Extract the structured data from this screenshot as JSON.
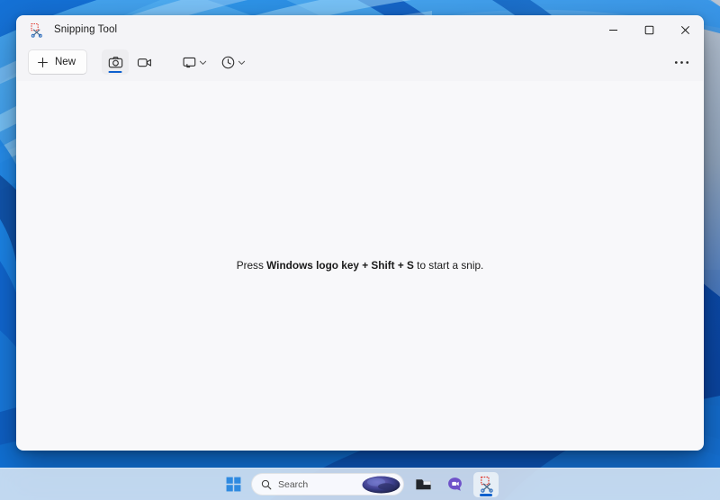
{
  "window": {
    "title": "Snipping Tool",
    "app_icon": "snipping-tool-icon",
    "caption": {
      "minimize_label": "Minimize",
      "maximize_label": "Maximize",
      "close_label": "Close"
    }
  },
  "toolbar": {
    "new_label": "New",
    "new_icon": "plus-icon",
    "modes": [
      {
        "name": "snip-mode-screenshot",
        "icon": "camera-icon",
        "selected": true
      },
      {
        "name": "snip-mode-record",
        "icon": "video-camera-icon",
        "selected": false
      }
    ],
    "dropdowns": [
      {
        "name": "snipping-mode-dropdown",
        "icon": "rectangle-snip-icon",
        "chevron": "chevron-down-icon"
      },
      {
        "name": "delay-dropdown",
        "icon": "clock-icon",
        "chevron": "chevron-down-icon"
      }
    ],
    "more_label": "•••",
    "more_icon": "ellipsis-icon"
  },
  "canvas": {
    "hint_prefix": "Press ",
    "hint_keys": "Windows logo key + Shift + S",
    "hint_suffix": " to start a snip."
  },
  "taskbar": {
    "start_icon": "windows-logo-icon",
    "search": {
      "icon": "search-icon",
      "placeholder": "Search",
      "value": ""
    },
    "apps": [
      {
        "name": "taskbar-file-explorer",
        "icon": "file-explorer-icon",
        "active": false
      },
      {
        "name": "taskbar-teams",
        "icon": "teams-chat-icon",
        "active": false
      },
      {
        "name": "taskbar-snipping-tool",
        "icon": "snipping-tool-icon",
        "active": true
      }
    ]
  },
  "colors": {
    "accent": "#0d60ce",
    "window_bg": "#f8f8fa",
    "titlebar_bg": "#f4f4f7",
    "text": "#1a1a1a",
    "wallpaper_blue": "#0a5fc4",
    "close_hover": "#e81123"
  }
}
